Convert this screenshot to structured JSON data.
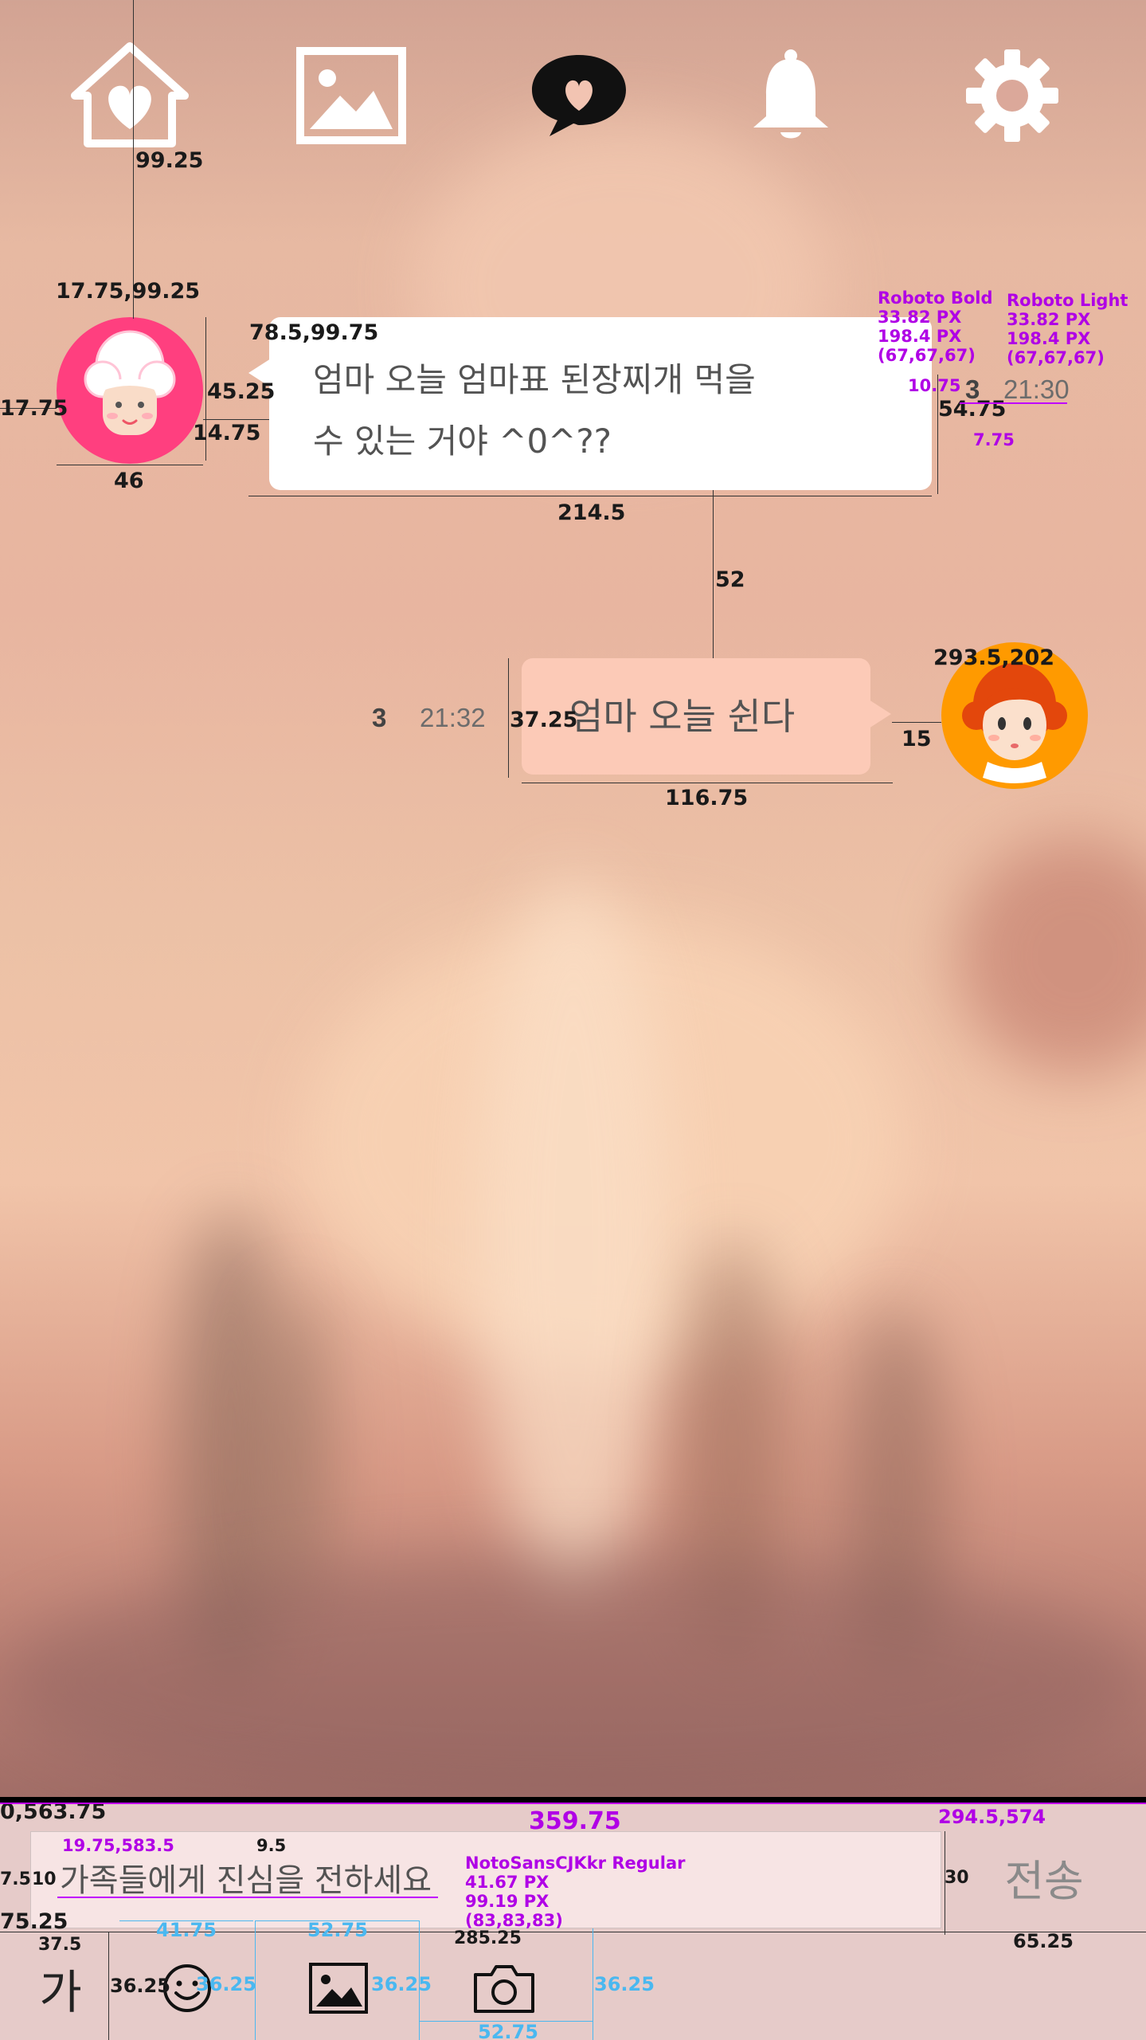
{
  "nav": {
    "items": [
      {
        "name": "home-heart-icon"
      },
      {
        "name": "gallery-icon"
      },
      {
        "name": "chat-heart-icon"
      },
      {
        "name": "bell-icon"
      },
      {
        "name": "gear-icon"
      }
    ]
  },
  "messages": [
    {
      "sender": "grandma",
      "avatar_icon": "grandma-avatar-icon",
      "text_line1": "엄마 오늘 엄마표 된장찌개 먹을",
      "text_line2": "수 있는 거야 ^0^??",
      "unread": "3",
      "time": "21:30",
      "avatar_color": "#ff3f7f"
    },
    {
      "sender": "me",
      "avatar_icon": "girl-avatar-icon",
      "text": "엄마 오늘 쉰다",
      "unread": "3",
      "time": "21:32",
      "avatar_color": "#ff9a00",
      "bubble_color": "#fccab7"
    }
  ],
  "input": {
    "placeholder": "가족들에게 진심을 전하세요",
    "send_label": "전송",
    "font_button_label": "가"
  },
  "tools": [
    {
      "name": "emoji-icon"
    },
    {
      "name": "image-icon"
    },
    {
      "name": "camera-icon"
    }
  ],
  "annotations": {
    "a_99_25": "99.25",
    "a_17_75_99_25": "17.75,99.25",
    "a_17_75": "17.75",
    "a_45_25": "45.25",
    "a_14_75": "14.75",
    "a_46": "46",
    "a_78_5_99_75": "78.5,99.75",
    "a_214_5": "214.5",
    "a_52": "52",
    "a_font1_l1": "Roboto Bold",
    "a_font1_l2": "33.82 PX",
    "a_font1_l3": "198.4 PX",
    "a_font1_l4": "(67,67,67)",
    "a_font2_l1": "Roboto Light",
    "a_font2_l2": "33.82 PX",
    "a_font2_l3": "198.4 PX",
    "a_font2_l4": "(67,67,67)",
    "a_10_75": "10.75",
    "a_54_75": "54.75",
    "a_7_75": "7.75",
    "a_293_5_202": "293.5,202",
    "a_37_25": "37.25",
    "a_15": "15",
    "a_116_75": "116.75",
    "a_0_563_75": "0,563.75",
    "a_359_75": "359.75",
    "a_294_5_574": "294.5,574",
    "a_19_75_583_5": "19.75,583.5",
    "a_9_5": "9.5",
    "a_7_5_10": "7.5",
    "a_10": "10",
    "a_30": "30",
    "a_75_25": "75.25",
    "a_37_5": "37.5",
    "a_36_25_a": "36.25",
    "a_41_75": "41.75",
    "a_36_25_b": "36.25",
    "a_52_75_a": "52.75",
    "a_36_25_c": "36.25",
    "a_285_25": "285.25",
    "a_36_25_d": "36.25",
    "a_52_75_b": "52.75",
    "a_65_25": "65.25",
    "a_noto_l1": "NotoSansCJKkr Regular",
    "a_noto_l2": "41.67 PX",
    "a_noto_l3": "99.19 PX",
    "a_noto_l4": "(83,83,83)"
  }
}
